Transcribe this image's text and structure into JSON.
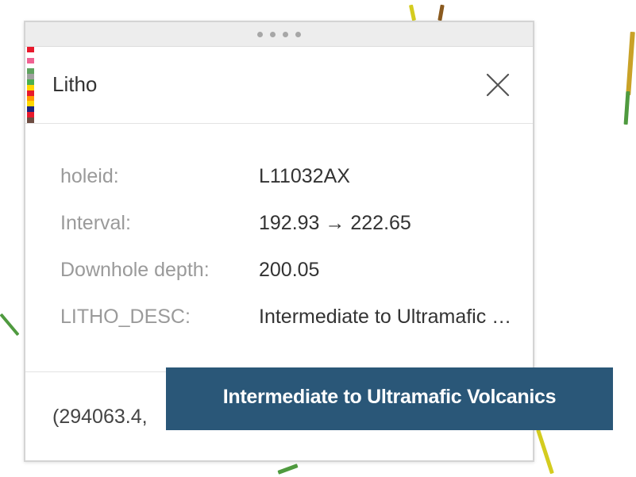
{
  "popup": {
    "title": "Litho",
    "close_icon": "close-icon",
    "legend_colors": [
      "#e8192c",
      "#ffffff",
      "#f06292",
      "#ffffff",
      "#5fa35f",
      "#a0a0a0",
      "#4caf50",
      "#ffd600",
      "#e8192c",
      "#ff9800",
      "#ffd600",
      "#1a237e",
      "#e8192c",
      "#6d4c41"
    ],
    "attributes": [
      {
        "key": "holeid:",
        "value": "L11032AX"
      },
      {
        "key": "Interval:",
        "value": "192.93 → 222.65"
      },
      {
        "key": "Downhole depth:",
        "value": "200.05"
      },
      {
        "key": "LITHO_DESC:",
        "value": "Intermediate to Ultramafic Volcanics"
      }
    ],
    "coordinates": "(294063.4,"
  },
  "tooltip": {
    "text": "Intermediate to Ultramafic Volcanics"
  },
  "colors": {
    "tooltip_bg": "#2a5778",
    "trace_yellow": "#d4cc1f",
    "trace_green": "#4f9a3f",
    "trace_brown": "#8a5a1f"
  }
}
